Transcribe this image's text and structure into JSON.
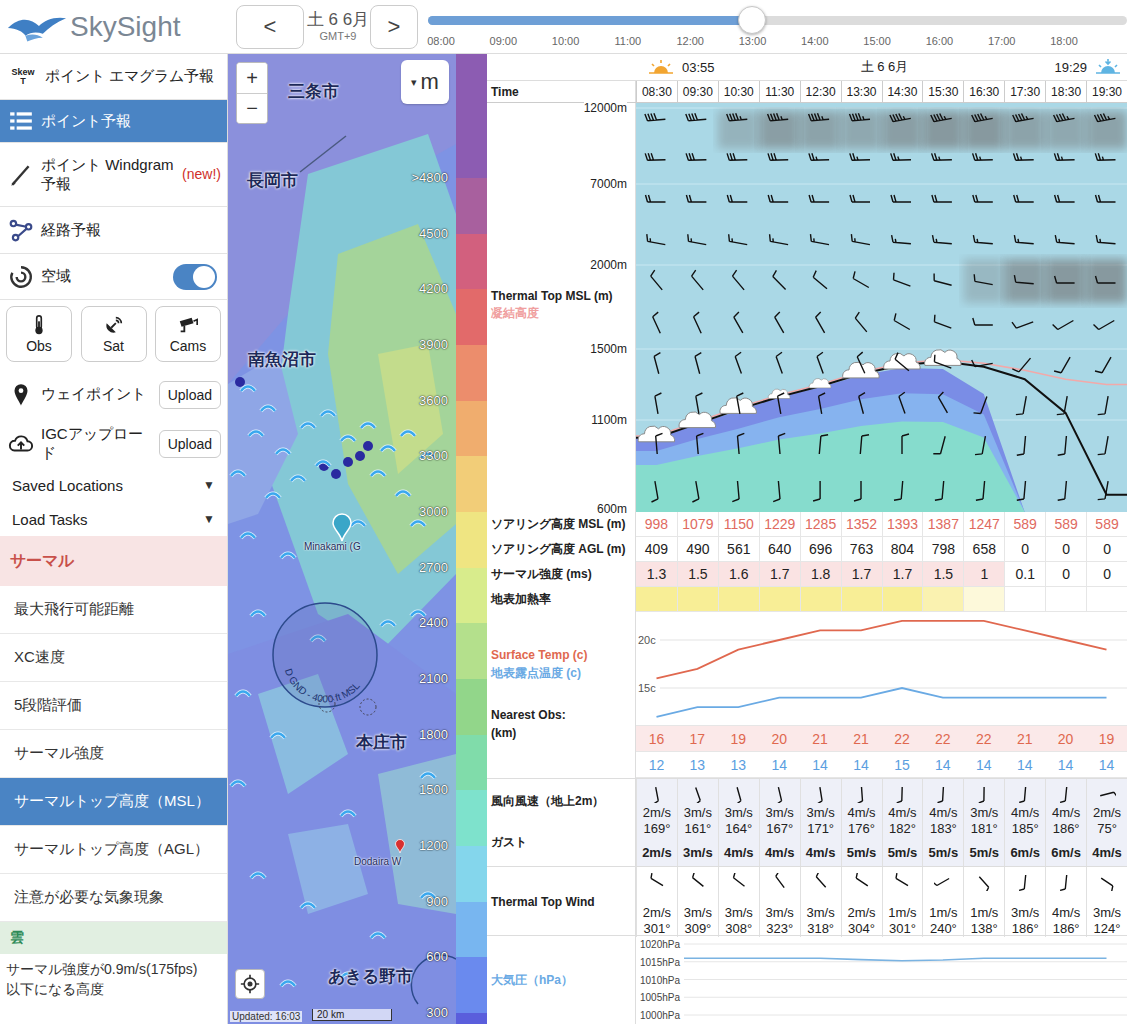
{
  "app": {
    "name": "SkySight"
  },
  "dateNav": {
    "prev": "<",
    "date": "土 6 6月",
    "timezone": "GMT+9",
    "next": ">"
  },
  "timeSlider": {
    "ticks": [
      "08:00",
      "09:00",
      "10:00",
      "11:00",
      "12:00",
      "13:00",
      "14:00",
      "15:00",
      "16:00",
      "17:00",
      "18:00"
    ],
    "level": 0.463
  },
  "sidebar": {
    "nav": [
      {
        "label": "ポイント エマグラム予報",
        "iconText": "Skew T",
        "selected": false
      },
      {
        "label": "ポイント予報",
        "selected": true
      },
      {
        "label": "ポイント Windgram 予報",
        "badge": "(new!)",
        "selected": false
      },
      {
        "label": "経路予報",
        "selected": false
      }
    ],
    "airspace": {
      "label": "空域",
      "on": true
    },
    "tools": [
      {
        "label": "Obs"
      },
      {
        "label": "Sat"
      },
      {
        "label": "Cams"
      }
    ],
    "uploads": [
      {
        "label": "ウェイポイント",
        "button": "Upload"
      },
      {
        "label": "IGCアップロード",
        "button": "Upload"
      }
    ],
    "dropdowns": [
      {
        "label": "Saved Locations",
        "caret": "▼"
      },
      {
        "label": "Load Tasks",
        "caret": "▼"
      }
    ],
    "thermal": {
      "title": "サーマル",
      "items": [
        {
          "label": "最大飛行可能距離",
          "selected": false
        },
        {
          "label": "XC速度",
          "selected": false
        },
        {
          "label": "5段階評価",
          "selected": false
        },
        {
          "label": "サーマル強度",
          "selected": false
        },
        {
          "label": "サーマルトップ高度（MSL）",
          "selected": true
        },
        {
          "label": "サーマルトップ高度（AGL）",
          "selected": false
        },
        {
          "label": "注意が必要な気象現象",
          "selected": false
        }
      ]
    },
    "cloud": {
      "title": "雲",
      "description": [
        "サーマル強度が0.9m/s(175fps)",
        "以下になる高度"
      ]
    }
  },
  "map": {
    "zoomIn": "+",
    "zoomOut": "−",
    "unitCaret": "▾",
    "unit": "m",
    "cities": [
      {
        "name": "三条市"
      },
      {
        "name": "長岡市"
      },
      {
        "name": "南魚沼市"
      },
      {
        "name": "本庄市"
      },
      {
        "name": "あきる野市"
      }
    ],
    "pins": [
      {
        "name": "Minakami (G",
        "color": "#3aa6c8"
      },
      {
        "name": "Dodaira W",
        "color": "#d83030"
      }
    ],
    "airspace": {
      "label": "D GND - 4000 ft MSL"
    },
    "updated": "Updated: 16:03",
    "scale": "20 km"
  },
  "legend": {
    "topColor": "#8c5cb2",
    "items": [
      {
        "label": ">4800",
        "color": "#a8609e"
      },
      {
        "label": "4500",
        "color": "#d2607e"
      },
      {
        "label": "4200",
        "color": "#e26a6a"
      },
      {
        "label": "3900",
        "color": "#ec8d6c"
      },
      {
        "label": "3600",
        "color": "#f0ad6e"
      },
      {
        "label": "3300",
        "color": "#f2cd78"
      },
      {
        "label": "3000",
        "color": "#efe582"
      },
      {
        "label": "2700",
        "color": "#d8ec8c"
      },
      {
        "label": "2400",
        "color": "#b4e08c"
      },
      {
        "label": "2100",
        "color": "#92d68a"
      },
      {
        "label": "1800",
        "color": "#80dcaa"
      },
      {
        "label": "1500",
        "color": "#7ee2cc"
      },
      {
        "label": "1200",
        "color": "#84d6ec"
      },
      {
        "label": "900",
        "color": "#78b6f0"
      },
      {
        "label": "600",
        "color": "#6a8aee"
      },
      {
        "label": "300",
        "color": "#5a5edc"
      }
    ]
  },
  "forecast": {
    "sun": {
      "sunrise": "03:55",
      "date": "土 6 6月",
      "sunset": "19:29"
    },
    "timeLabel": "Time",
    "times": [
      "08:30",
      "09:30",
      "10:30",
      "11:30",
      "12:30",
      "13:30",
      "14:30",
      "15:30",
      "16:30",
      "17:30",
      "18:30",
      "19:30"
    ],
    "chart": {
      "title": "Thermal Top MSL (m)",
      "subtitle": "凝結高度",
      "ticks": [
        "12000m",
        "7000m",
        "2000m",
        "1500m",
        "1100m",
        "600m"
      ],
      "tickValues": [
        12000,
        7000,
        2000,
        1500,
        1100,
        600
      ],
      "thermalTop": [
        998,
        1079,
        1150,
        1229,
        1285,
        1352,
        1393,
        1387,
        1247,
        589,
        589,
        589
      ],
      "cloudBase": [
        1000,
        1080,
        1160,
        1230,
        1290,
        1360,
        1410,
        1430,
        1400,
        1330,
        1140,
        680
      ],
      "condensation": [
        1010,
        1090,
        1170,
        1240,
        1300,
        1370,
        1420,
        1440,
        1420,
        1380,
        1330,
        1300
      ],
      "clouds": [
        1,
        1,
        1,
        0.6,
        0.6,
        1,
        1,
        1,
        0,
        0,
        0,
        0
      ],
      "highCloud": [
        0,
        0,
        0.35,
        0.55,
        0.5,
        0.45,
        0.55,
        0.6,
        0.6,
        0.5,
        0.45,
        0.5
      ],
      "midCloud": [
        0,
        0,
        0,
        0,
        0,
        0,
        0,
        0,
        0.3,
        0.55,
        0.6,
        0.6
      ],
      "winds": [
        {
          "dirs": [
            265,
            265,
            265,
            265,
            265,
            265,
            260,
            260,
            260,
            260,
            260,
            260
          ],
          "speeds": [
            40,
            40,
            45,
            45,
            45,
            45,
            45,
            45,
            45,
            45,
            45,
            45
          ]
        },
        {
          "dirs": [
            268,
            268,
            268,
            268,
            268,
            268,
            268,
            268,
            268,
            268,
            268,
            268
          ],
          "speeds": [
            30,
            30,
            30,
            30,
            25,
            25,
            25,
            25,
            25,
            25,
            25,
            25
          ]
        },
        {
          "dirs": [
            270,
            270,
            270,
            270,
            270,
            270,
            270,
            270,
            270,
            270,
            270,
            270
          ],
          "speeds": [
            20,
            20,
            20,
            20,
            20,
            20,
            20,
            20,
            20,
            20,
            20,
            20
          ]
        },
        {
          "dirs": [
            280,
            280,
            280,
            280,
            280,
            280,
            275,
            275,
            275,
            275,
            275,
            275
          ],
          "speeds": [
            15,
            15,
            15,
            15,
            15,
            15,
            15,
            15,
            15,
            15,
            15,
            15
          ]
        },
        {
          "dirs": [
            320,
            320,
            320,
            315,
            310,
            300,
            290,
            285,
            280,
            275,
            270,
            270
          ],
          "speeds": [
            10,
            10,
            10,
            10,
            10,
            10,
            10,
            10,
            10,
            10,
            10,
            10
          ]
        },
        {
          "dirs": [
            335,
            335,
            330,
            330,
            330,
            320,
            300,
            290,
            270,
            250,
            240,
            240
          ],
          "speeds": [
            10,
            10,
            10,
            10,
            10,
            10,
            10,
            10,
            10,
            10,
            10,
            10
          ]
        },
        {
          "dirs": [
            345,
            345,
            340,
            340,
            340,
            335,
            310,
            290,
            260,
            220,
            210,
            210
          ],
          "speeds": [
            10,
            10,
            10,
            10,
            10,
            10,
            10,
            10,
            10,
            10,
            10,
            10
          ]
        },
        {
          "dirs": [
            350,
            350,
            350,
            350,
            350,
            345,
            340,
            330,
            200,
            190,
            190,
            190
          ],
          "speeds": [
            10,
            10,
            10,
            10,
            10,
            10,
            10,
            10,
            10,
            10,
            10,
            10
          ]
        },
        {
          "dirs": [
            355,
            355,
            355,
            355,
            5,
            5,
            0,
            195,
            190,
            185,
            185,
            190
          ],
          "speeds": [
            10,
            10,
            10,
            10,
            10,
            10,
            10,
            10,
            10,
            10,
            10,
            10
          ]
        },
        {
          "dirs": [
            170,
            170,
            175,
            175,
            180,
            180,
            185,
            185,
            185,
            185,
            185,
            190
          ],
          "speeds": [
            10,
            10,
            10,
            10,
            10,
            10,
            10,
            10,
            10,
            10,
            10,
            10
          ]
        }
      ]
    },
    "soaringMsl": {
      "label": "ソアリング高度 MSL (m)",
      "values": [
        "998",
        "1079",
        "1150",
        "1229",
        "1285",
        "1352",
        "1393",
        "1387",
        "1247",
        "589",
        "589",
        "589"
      ]
    },
    "soaringAgl": {
      "label": "ソアリング高度 AGL (m)",
      "values": [
        "409",
        "490",
        "561",
        "640",
        "696",
        "763",
        "804",
        "798",
        "658",
        "0",
        "0",
        "0"
      ]
    },
    "strength": {
      "label": "サーマル強度 (ms)",
      "values": [
        "1.3",
        "1.5",
        "1.6",
        "1.7",
        "1.8",
        "1.7",
        "1.7",
        "1.5",
        "1",
        "0.1",
        "0",
        "0"
      ]
    },
    "heating": {
      "label": "地表加熱率",
      "levels": [
        1,
        1,
        1,
        1,
        1,
        1,
        1,
        0.75,
        0.35,
        0,
        0,
        0
      ]
    },
    "surface": {
      "tempLabel": "Surface Temp (c)",
      "dewLabel": "地表露点温度 (c)",
      "obsLabel": "Nearest Obs:",
      "kmLabel": "(km)",
      "ticks": [
        "20c",
        "15c"
      ],
      "tickValues": [
        20,
        15
      ],
      "temp": [
        16,
        17,
        19,
        20,
        21,
        21,
        22,
        22,
        22,
        21,
        20,
        19
      ],
      "dew": [
        12,
        13,
        13,
        14,
        14,
        14,
        15,
        14,
        14,
        14,
        14,
        14
      ],
      "tempText": [
        "16",
        "17",
        "19",
        "20",
        "21",
        "21",
        "22",
        "22",
        "22",
        "21",
        "20",
        "19"
      ],
      "dewText": [
        "12",
        "13",
        "13",
        "14",
        "14",
        "14",
        "15",
        "14",
        "14",
        "14",
        "14",
        "14"
      ]
    },
    "wind2m": {
      "label": "風向風速（地上2m）",
      "gustLabel": "ガスト",
      "cells": [
        {
          "speed": "2m/s",
          "dir": "169°",
          "gust": "2m/s"
        },
        {
          "speed": "3m/s",
          "dir": "161°",
          "gust": "3m/s"
        },
        {
          "speed": "3m/s",
          "dir": "164°",
          "gust": "4m/s"
        },
        {
          "speed": "3m/s",
          "dir": "167°",
          "gust": "4m/s"
        },
        {
          "speed": "3m/s",
          "dir": "171°",
          "gust": "4m/s"
        },
        {
          "speed": "4m/s",
          "dir": "176°",
          "gust": "5m/s"
        },
        {
          "speed": "4m/s",
          "dir": "182°",
          "gust": "5m/s"
        },
        {
          "speed": "4m/s",
          "dir": "183°",
          "gust": "5m/s"
        },
        {
          "speed": "3m/s",
          "dir": "181°",
          "gust": "5m/s"
        },
        {
          "speed": "4m/s",
          "dir": "185°",
          "gust": "6m/s"
        },
        {
          "speed": "4m/s",
          "dir": "186°",
          "gust": "6m/s"
        },
        {
          "speed": "2m/s",
          "dir": "75°",
          "gust": "4m/s"
        }
      ]
    },
    "thermalWind": {
      "label": "Thermal Top Wind",
      "cells": [
        {
          "speed": "2m/s",
          "dir": "301°"
        },
        {
          "speed": "3m/s",
          "dir": "309°"
        },
        {
          "speed": "3m/s",
          "dir": "308°"
        },
        {
          "speed": "3m/s",
          "dir": "323°"
        },
        {
          "speed": "3m/s",
          "dir": "318°"
        },
        {
          "speed": "2m/s",
          "dir": "304°"
        },
        {
          "speed": "1m/s",
          "dir": "301°"
        },
        {
          "speed": "1m/s",
          "dir": "240°"
        },
        {
          "speed": "1m/s",
          "dir": "138°"
        },
        {
          "speed": "3m/s",
          "dir": "186°"
        },
        {
          "speed": "4m/s",
          "dir": "186°"
        },
        {
          "speed": "3m/s",
          "dir": "124°"
        }
      ]
    },
    "pressure": {
      "label": "大気圧（hPa）",
      "ticks": [
        "1020hPa",
        "1015hPa",
        "1010hPa",
        "1005hPa",
        "1000hPa"
      ],
      "tickValues": [
        1020,
        1015,
        1010,
        1005,
        1000
      ],
      "values": [
        1016,
        1016,
        1016,
        1016,
        1016,
        1015.6,
        1015.3,
        1015.5,
        1016,
        1016,
        1016,
        1016
      ]
    }
  }
}
